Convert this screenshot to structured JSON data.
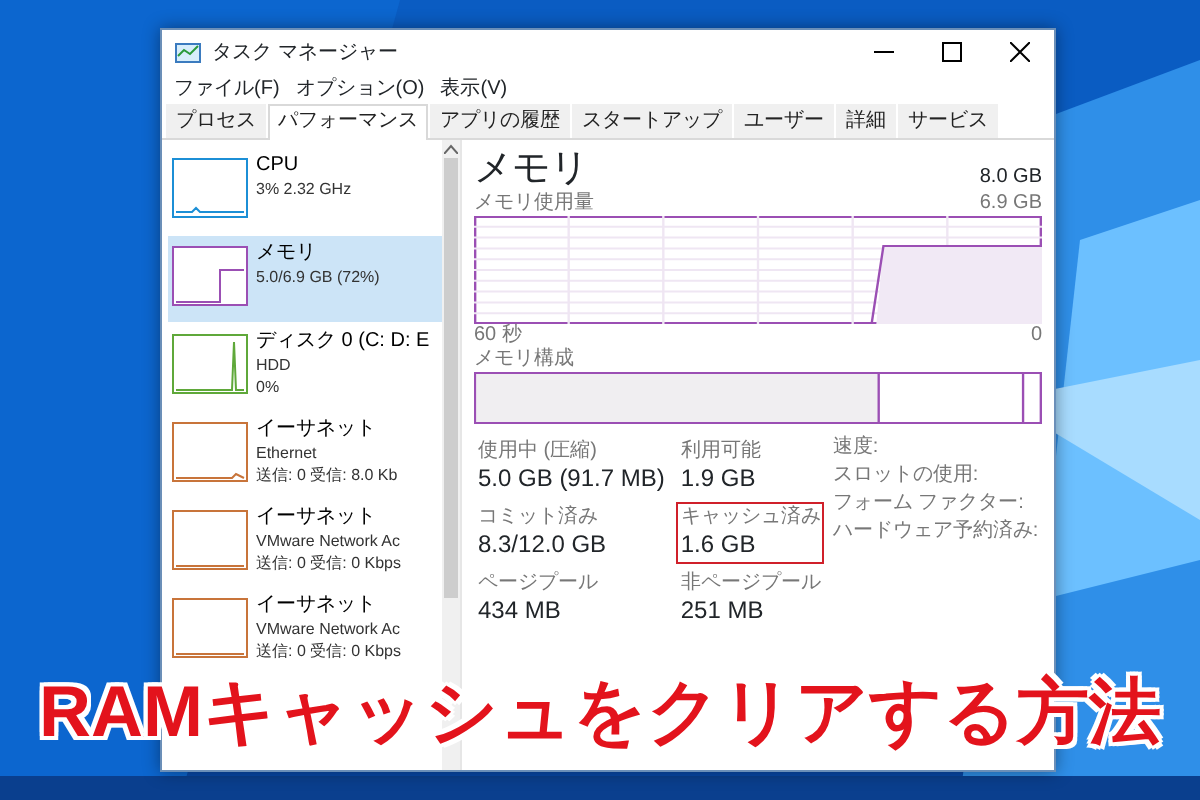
{
  "window": {
    "title": "タスク マネージャー"
  },
  "menu": [
    "ファイル(F)",
    "オプション(O)",
    "表示(V)"
  ],
  "tabs": [
    {
      "label": "プロセス",
      "selected": false
    },
    {
      "label": "パフォーマンス",
      "selected": true
    },
    {
      "label": "アプリの履歴",
      "selected": false
    },
    {
      "label": "スタートアップ",
      "selected": false
    },
    {
      "label": "ユーザー",
      "selected": false
    },
    {
      "label": "詳細",
      "selected": false
    },
    {
      "label": "サービス",
      "selected": false
    }
  ],
  "sidebar": {
    "items": [
      {
        "title": "CPU",
        "lines": [
          "3% 2.32 GHz"
        ],
        "color": "#1c8fd6",
        "selected": false
      },
      {
        "title": "メモリ",
        "lines": [
          "5.0/6.9 GB (72%)"
        ],
        "color": "#9b4fb4",
        "selected": true
      },
      {
        "title": "ディスク 0 (C: D: E",
        "lines": [
          "HDD",
          "0%"
        ],
        "color": "#5fa83a",
        "selected": false
      },
      {
        "title": "イーサネット",
        "lines": [
          "Ethernet",
          "送信: 0 受信: 8.0 Kb"
        ],
        "color": "#c8743a",
        "selected": false
      },
      {
        "title": "イーサネット",
        "lines": [
          "VMware Network Ac",
          "送信: 0 受信: 0 Kbps"
        ],
        "color": "#c8743a",
        "selected": false
      },
      {
        "title": "イーサネット",
        "lines": [
          "VMware Network Ac",
          "送信: 0 受信: 0 Kbps"
        ],
        "color": "#c8743a",
        "selected": false
      }
    ]
  },
  "detail": {
    "title": "メモリ",
    "total": "8.0 GB",
    "usage_graph": {
      "label": "メモリ使用量",
      "max": "6.9 GB",
      "time": "60 秒",
      "min": "0"
    },
    "composition_label": "メモリ構成",
    "stats": [
      {
        "label": "使用中 (圧縮)",
        "value": "5.0 GB (91.7 MB)",
        "highlighted": false
      },
      {
        "label": "利用可能",
        "value": "1.9 GB",
        "highlighted": false
      },
      {
        "label": "コミット済み",
        "value": "8.3/12.0 GB",
        "highlighted": false
      },
      {
        "label": "キャッシュ済み",
        "value": "1.6 GB",
        "highlighted": true
      },
      {
        "label": "ページプール",
        "value": "434 MB",
        "highlighted": false
      },
      {
        "label": "非ページプール",
        "value": "251 MB",
        "highlighted": false
      }
    ],
    "details": [
      "速度:",
      "スロットの使用:",
      "フォーム ファクター:",
      "ハードウェア予約済み:"
    ]
  },
  "overlay_title": "RAMキャッシュをクリアする方法"
}
